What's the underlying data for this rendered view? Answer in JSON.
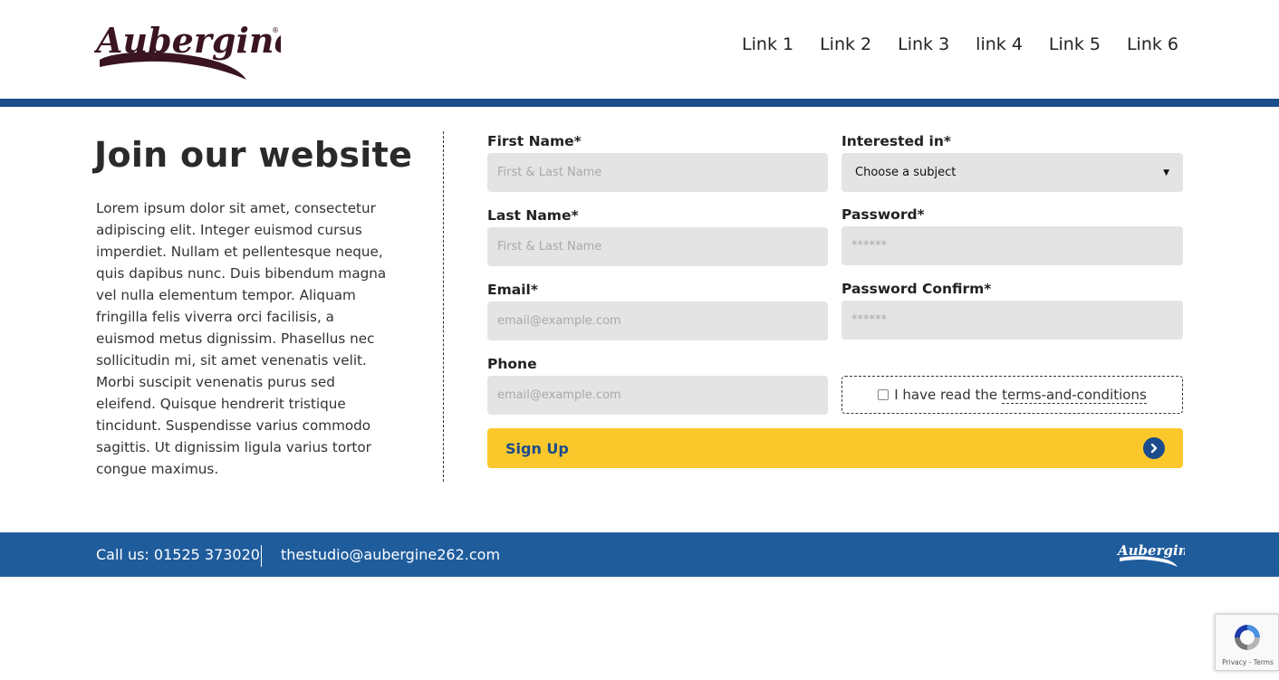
{
  "header": {
    "logo_alt": "Aubergine",
    "nav": [
      "Link 1",
      "Link 2",
      "Link 3",
      "link 4",
      "Link 5",
      "Link 6"
    ]
  },
  "intro": {
    "title": "Join our website",
    "body": "Lorem ipsum dolor sit amet, consectetur adipiscing elit. Integer euismod cursus imperdiet. Nullam et pellentesque neque, quis dapibus nunc. Duis bibendum magna vel nulla elementum tempor. Aliquam fringilla felis viverra orci facilisis, a euismod metus dignissim. Phasellus nec sollicitudin mi, sit amet venenatis velit. Morbi suscipit venenatis purus sed eleifend. Quisque hendrerit tristique tincidunt. Suspendisse varius commodo sagittis. Ut dignissim ligula varius tortor congue maximus."
  },
  "form": {
    "first_name": {
      "label": "First Name*",
      "placeholder": "First & Last Name"
    },
    "last_name": {
      "label": "Last Name*",
      "placeholder": "First & Last Name"
    },
    "email": {
      "label": "Email*",
      "placeholder": "email@example.com"
    },
    "phone": {
      "label": "Phone",
      "placeholder": "email@example.com"
    },
    "interested_in": {
      "label": "Interested in*",
      "selected": "Choose a subject"
    },
    "password": {
      "label": "Password*",
      "placeholder": "******"
    },
    "password_confirm": {
      "label": "Password Confirm*",
      "placeholder": "******"
    },
    "terms": {
      "prefix": "I have read the",
      "link": "terms-and-conditions",
      "checked": false
    },
    "submit_label": "Sign Up"
  },
  "footer": {
    "call": "Call us: 01525 373020",
    "email": "thestudio@aubergine262.com"
  },
  "recaptcha": {
    "text": "Privacy - Terms"
  },
  "colors": {
    "brand_blue": "#1d4c8c",
    "footer_blue": "#1f5c9c",
    "button_yellow": "#fbc82c",
    "input_grey": "#e4e4e4",
    "logo_dark": "#3a1520"
  },
  "icons": [
    "arrow-right-circle-icon",
    "recaptcha-icon",
    "chevron-down-icon"
  ]
}
